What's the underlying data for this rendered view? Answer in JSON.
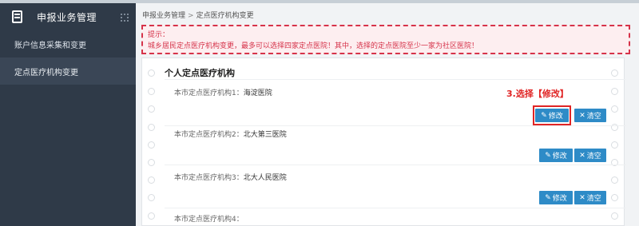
{
  "sidebar": {
    "title": "申报业务管理",
    "items": [
      {
        "label": "账户信息采集和变更"
      },
      {
        "label": "定点医疗机构变更"
      }
    ]
  },
  "breadcrumb": {
    "root": "申报业务管理",
    "separator": ">",
    "current": "定点医疗机构变更"
  },
  "notice": {
    "title": "提示：",
    "body": "城乡居民定点医疗机构变更，最多可以选择四家定点医院！其中，选择的定点医院至少一家为社区医院！"
  },
  "card": {
    "title": "个人定点医疗机构",
    "rows": [
      {
        "label": "本市定点医疗机构1：",
        "value": "海淀医院"
      },
      {
        "label": "本市定点医疗机构2：",
        "value": "北大第三医院"
      },
      {
        "label": "本市定点医疗机构3：",
        "value": "北大人民医院"
      },
      {
        "label": "本市定点医疗机构4：",
        "value": ""
      }
    ],
    "edit_label": "修改",
    "clear_label": "清空"
  },
  "annotation": {
    "text": "3.选择【修改】"
  },
  "colors": {
    "sidebar_bg": "#2f3a48",
    "button": "#2e8bc7",
    "notice_red": "#d6334a",
    "annotation_red": "#e02424"
  }
}
